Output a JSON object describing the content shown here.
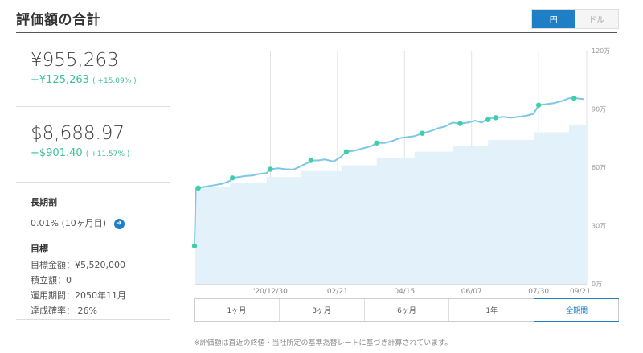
{
  "header": {
    "title": "評価額の合計"
  },
  "currency_toggle": {
    "yen": "円",
    "dollar": "ドル"
  },
  "totals": {
    "yen_value": "¥955,263",
    "yen_gain": "+¥125,263",
    "yen_gain_pct": "( +15.09% )",
    "usd_value": "$8,688.97",
    "usd_gain": "+$901.40",
    "usd_gain_pct": "( +11.57% )"
  },
  "long_term_discount": {
    "title": "長期割",
    "value": "0.01% (10ヶ月目)"
  },
  "goal": {
    "title": "目標",
    "amount": "目標金額：¥5,520,000",
    "deposit": "積立額：0",
    "period": "運用期間：2050年11月",
    "probability": "達成確率： 26%"
  },
  "ranges": [
    "1ヶ月",
    "3ヶ月",
    "6ヶ月",
    "1年",
    "全期間"
  ],
  "active_range": "全期間",
  "footnote": "※評価額は直近の終値・当社所定の基準為替レートに基づき計算されています。",
  "colors": {
    "accent": "#1f7fc6",
    "gain": "#3fbf9a",
    "line": "#7cc6e8",
    "area": "#e3f1fa",
    "marker": "#3fcfa4"
  },
  "chart_data": {
    "type": "area",
    "x_ticks": [
      "'20/12/30",
      "02/21",
      "04/15",
      "06/07",
      "07/30",
      "09/21"
    ],
    "y_ticks": [
      "0万",
      "30万",
      "60万",
      "90万",
      "120万"
    ],
    "ylim": [
      0,
      120
    ],
    "y_unit": "万円",
    "x_range_days": [
      0,
      310
    ],
    "x_tick_days": [
      60,
      113,
      166,
      219,
      272,
      325
    ],
    "valuation": [
      [
        0,
        19.5
      ],
      [
        1,
        49
      ],
      [
        4,
        49.5
      ],
      [
        10,
        50.2
      ],
      [
        16,
        50.8
      ],
      [
        22,
        51.5
      ],
      [
        28,
        53
      ],
      [
        30,
        54.5
      ],
      [
        35,
        55
      ],
      [
        40,
        55.5
      ],
      [
        46,
        55.8
      ],
      [
        50,
        56.5
      ],
      [
        57,
        57
      ],
      [
        60,
        59
      ],
      [
        66,
        59.5
      ],
      [
        72,
        59
      ],
      [
        78,
        58.8
      ],
      [
        84,
        60.5
      ],
      [
        90,
        62.5
      ],
      [
        92,
        63.5
      ],
      [
        98,
        63.5
      ],
      [
        103,
        64
      ],
      [
        110,
        63
      ],
      [
        116,
        65.5
      ],
      [
        120,
        68
      ],
      [
        126,
        68.5
      ],
      [
        132,
        69.5
      ],
      [
        140,
        71
      ],
      [
        144,
        72.5
      ],
      [
        150,
        72.5
      ],
      [
        156,
        73.5
      ],
      [
        162,
        75
      ],
      [
        168,
        75.5
      ],
      [
        174,
        76
      ],
      [
        180,
        77.5
      ],
      [
        186,
        78.5
      ],
      [
        192,
        80
      ],
      [
        198,
        81
      ],
      [
        204,
        83
      ],
      [
        210,
        82.5
      ],
      [
        216,
        83
      ],
      [
        222,
        84
      ],
      [
        227,
        83
      ],
      [
        232,
        85
      ],
      [
        238,
        85.5
      ],
      [
        244,
        86
      ],
      [
        250,
        85.5
      ],
      [
        256,
        86
      ],
      [
        262,
        86.5
      ],
      [
        268,
        87.5
      ],
      [
        272,
        92
      ],
      [
        278,
        92.5
      ],
      [
        284,
        93
      ],
      [
        290,
        94
      ],
      [
        296,
        95.5
      ],
      [
        302,
        95.5
      ],
      [
        308,
        95
      ]
    ],
    "deposits": [
      [
        0,
        20
      ],
      [
        1,
        50
      ],
      [
        28,
        52
      ],
      [
        57,
        55
      ],
      [
        84,
        58
      ],
      [
        116,
        61
      ],
      [
        144,
        65
      ],
      [
        174,
        68
      ],
      [
        204,
        71
      ],
      [
        232,
        74
      ],
      [
        268,
        78
      ],
      [
        296,
        82
      ],
      [
        310,
        82
      ]
    ],
    "markers": [
      [
        0,
        19.5
      ],
      [
        3,
        49.3
      ],
      [
        30,
        54.5
      ],
      [
        60,
        59
      ],
      [
        92,
        63.5
      ],
      [
        120,
        68
      ],
      [
        144,
        72.5
      ],
      [
        180,
        77.5
      ],
      [
        210,
        82.5
      ],
      [
        232,
        84.5
      ],
      [
        238,
        85.5
      ],
      [
        272,
        92
      ],
      [
        300,
        95.5
      ]
    ]
  }
}
